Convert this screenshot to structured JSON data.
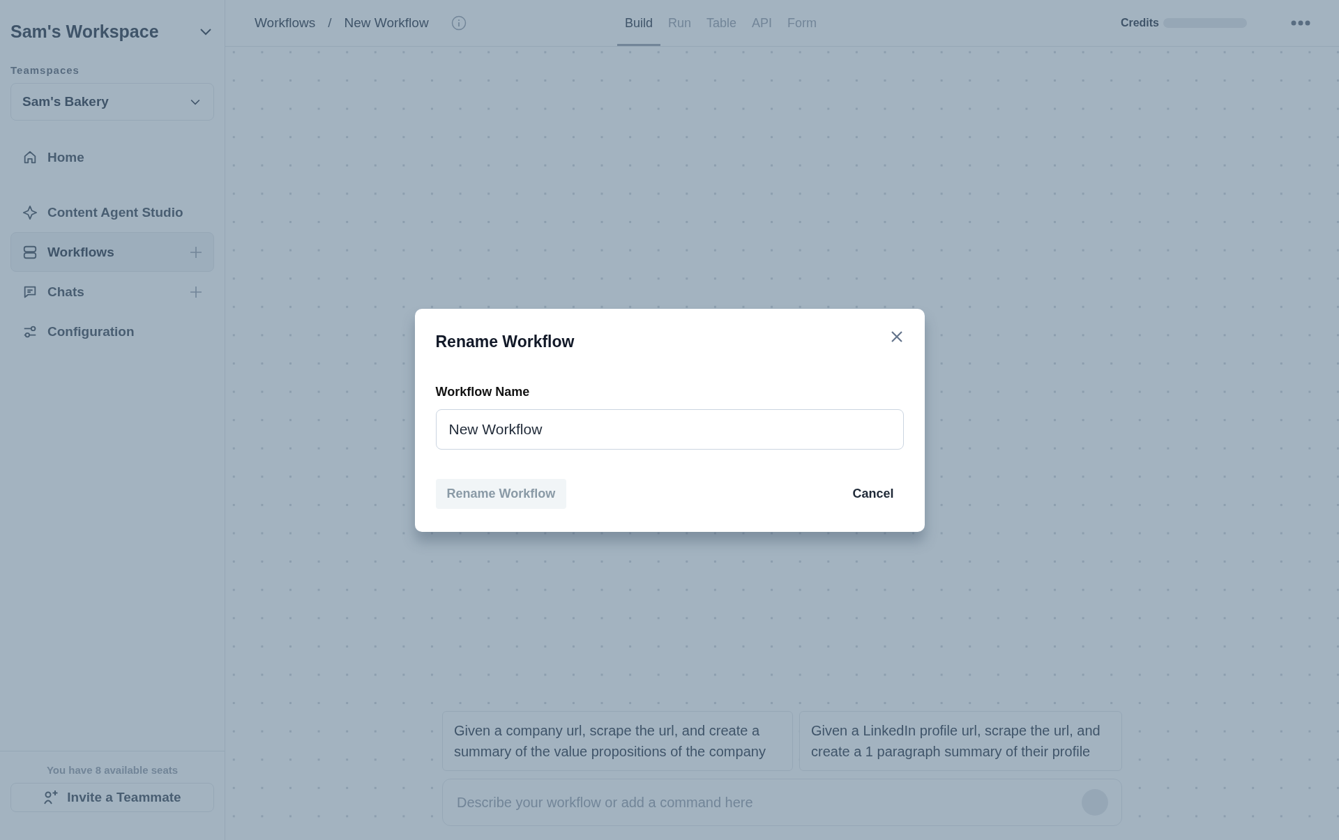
{
  "sidebar": {
    "workspace": "Sam's Workspace",
    "teamspaces_label": "Teamspaces",
    "teamspace": "Sam's Bakery",
    "items": [
      {
        "label": "Home",
        "selected": false,
        "addable": false
      },
      {
        "label": "Content Agent Studio",
        "selected": false,
        "addable": false
      },
      {
        "label": "Workflows",
        "selected": true,
        "addable": true
      },
      {
        "label": "Chats",
        "selected": false,
        "addable": true
      },
      {
        "label": "Configuration",
        "selected": false,
        "addable": false
      }
    ],
    "seats": "You have 8 available seats",
    "invite": "Invite a Teammate"
  },
  "breadcrumb": {
    "parent": "Workflows",
    "separator": "/",
    "current": "New Workflow"
  },
  "tabs": [
    {
      "label": "Build",
      "selected": true
    },
    {
      "label": "Run",
      "selected": false
    },
    {
      "label": "Table",
      "selected": false
    },
    {
      "label": "API",
      "selected": false
    },
    {
      "label": "Form",
      "selected": false
    }
  ],
  "credits": "Credits",
  "suggestions": [
    "Given a company url, scrape the url, and create a summary of the value propositions of the company",
    "Given a LinkedIn profile url, scrape the url, and create a 1 paragraph summary of their profile"
  ],
  "prompt": {
    "placeholder": "Describe your workflow or add a command here"
  },
  "dialog": {
    "title": "Rename Workflow",
    "field_label": "Workflow Name",
    "value": "New Workflow",
    "submit": {
      "label": "Rename Workflow",
      "disabled": true
    },
    "cancel": "Cancel"
  }
}
